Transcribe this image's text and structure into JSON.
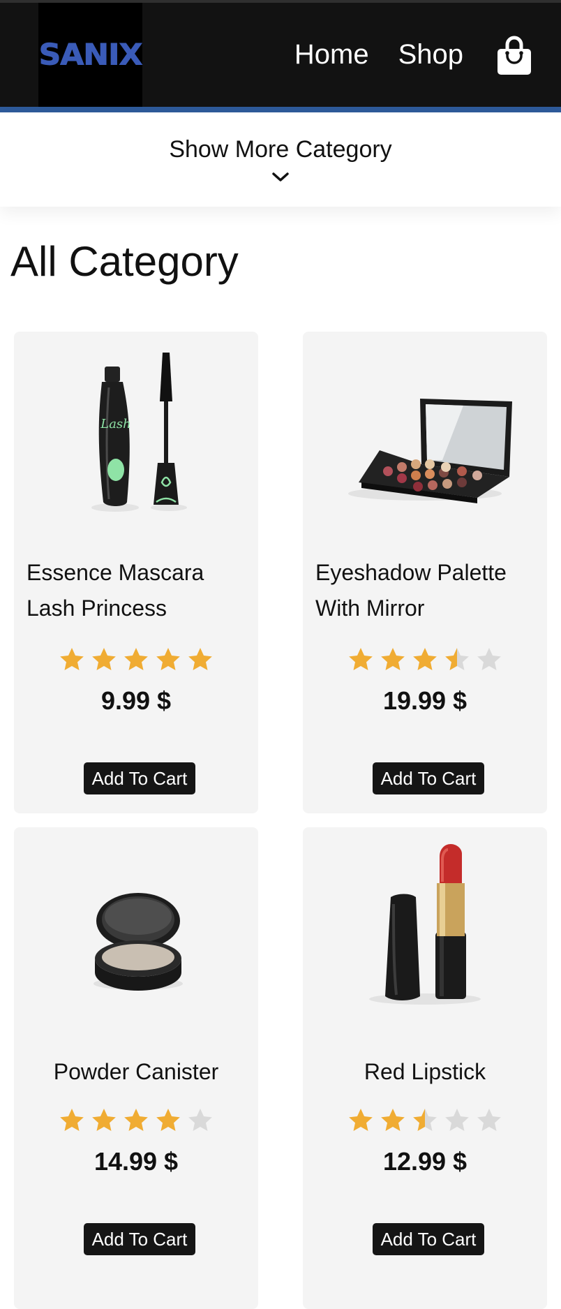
{
  "header": {
    "logo_text": "SANIX",
    "nav": [
      {
        "label": "Home"
      },
      {
        "label": "Shop"
      }
    ],
    "cart_icon": "shopping-bag-icon"
  },
  "category_toggle": {
    "label": "Show More Category",
    "icon": "chevron-down-icon"
  },
  "section_title": "All Category",
  "colors": {
    "header_bg": "#121212",
    "accent_line": "#2e5a9a",
    "logo": "#3a5bb8",
    "star_filled": "#f0ac33",
    "star_empty": "#d9d9d9",
    "card_bg": "#f4f4f4"
  },
  "products": [
    {
      "name": "Essence Mascara Lash Princess",
      "rating": 5,
      "price": "9.99 $",
      "button": "Add To Cart"
    },
    {
      "name": "Eyeshadow Palette With Mirror",
      "rating": 3.5,
      "price": "19.99 $",
      "button": "Add To Cart"
    },
    {
      "name": "Powder Canister",
      "rating": 4,
      "price": "14.99 $",
      "button": "Add To Cart"
    },
    {
      "name": "Red Lipstick",
      "rating": 2.5,
      "price": "12.99 $",
      "button": "Add To Cart"
    }
  ]
}
